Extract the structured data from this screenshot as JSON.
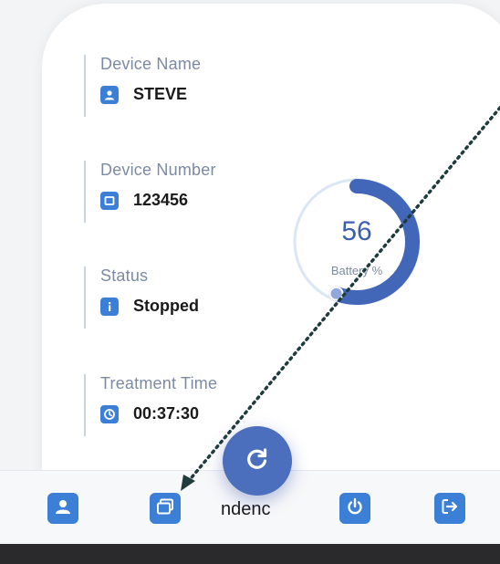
{
  "fields": [
    {
      "label": "Device Name",
      "value": "STEVE",
      "icon": "user-icon"
    },
    {
      "label": "Device Number",
      "value": "123456",
      "icon": "square-icon"
    },
    {
      "label": "Status",
      "value": "Stopped",
      "icon": "info-icon"
    },
    {
      "label": "Treatment Time",
      "value": "00:37:30",
      "icon": "clock-icon"
    }
  ],
  "battery": {
    "value": "56",
    "label": "Battery %",
    "fraction": 0.56
  },
  "nav": {
    "items": [
      {
        "icon": "user-icon"
      },
      {
        "icon": "windows-icon"
      },
      {
        "icon": "power-icon"
      },
      {
        "icon": "logout-icon"
      }
    ],
    "partial_text": "ndenc"
  },
  "fab": {
    "icon": "refresh-icon"
  },
  "colors": {
    "accent": "#3c7fd6",
    "gauge_fill": "#4266b8",
    "gauge_track": "#dbe6f5",
    "label": "#7c8aa3"
  }
}
